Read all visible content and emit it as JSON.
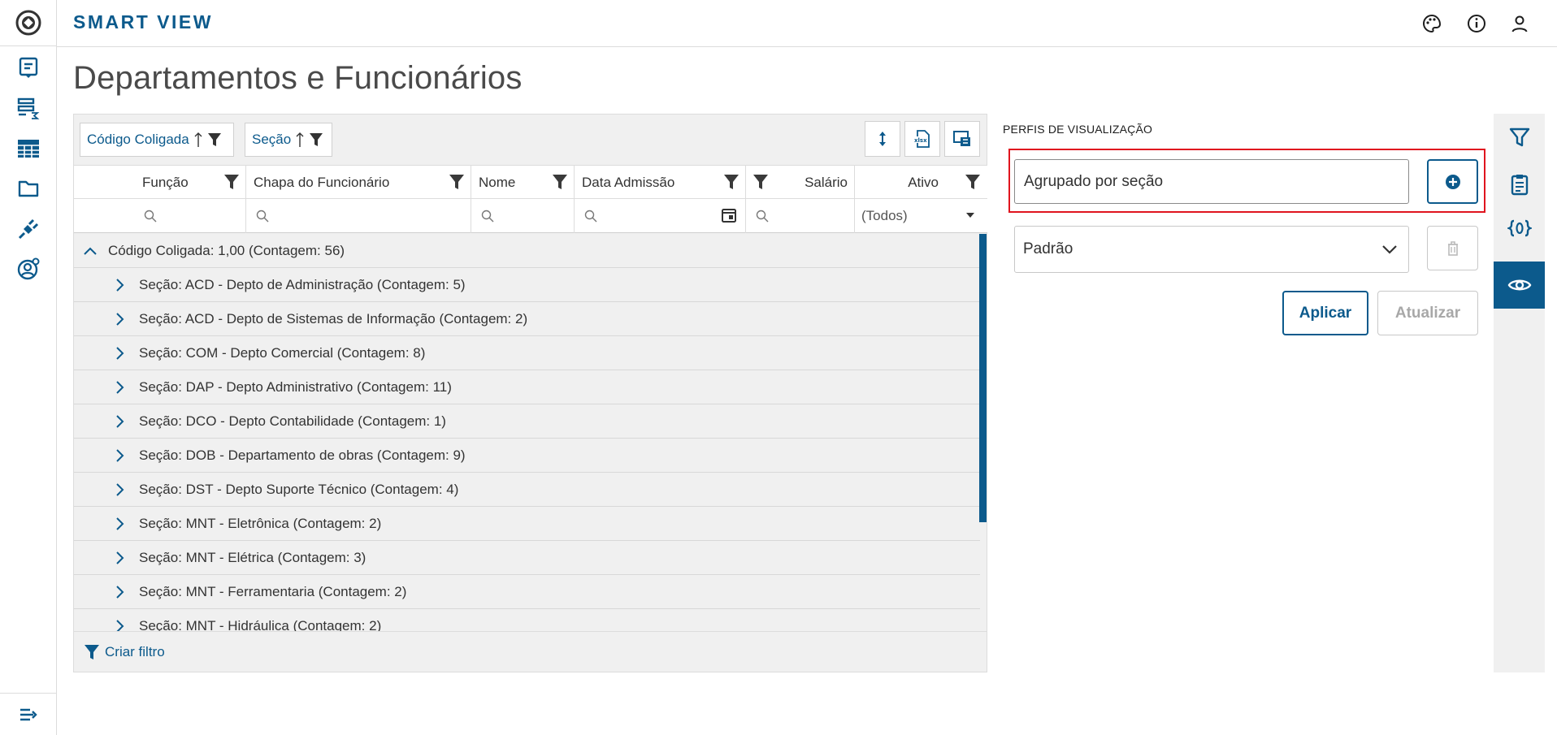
{
  "header": {
    "brand": "SMART VIEW",
    "icons": [
      "palette-icon",
      "info-icon",
      "user-icon"
    ]
  },
  "nav": {
    "icons": [
      "report-icon",
      "summary-icon",
      "table-icon",
      "folder-icon",
      "plug-icon",
      "user-settings-icon"
    ],
    "collapse_icon": "expand-menu-icon"
  },
  "page": {
    "title": "Departamentos e Funcionários"
  },
  "grid": {
    "group_chips": [
      "Código Coligada",
      "Seção"
    ],
    "toolbar_icons": [
      "row-height-icon",
      "export-xlsx-icon",
      "column-chooser-icon"
    ],
    "columns": [
      "Função",
      "Chapa do Funcionário",
      "Nome",
      "Data Admissão",
      "Salário",
      "Ativo"
    ],
    "active_filter_value": "(Todos)",
    "top_group": "Código Coligada: 1,00 (Contagem: 56)",
    "groups": [
      "Seção: ACD - Depto de Administração (Contagem: 5)",
      "Seção: ACD - Depto de Sistemas de Informação (Contagem: 2)",
      "Seção: COM - Depto Comercial (Contagem: 8)",
      "Seção: DAP - Depto Administrativo (Contagem: 11)",
      "Seção: DCO - Depto Contabilidade (Contagem: 1)",
      "Seção: DOB - Departamento de obras (Contagem: 9)",
      "Seção: DST - Depto Suporte Técnico (Contagem: 4)",
      "Seção: MNT - Eletrônica (Contagem: 2)",
      "Seção: MNT - Elétrica (Contagem: 3)",
      "Seção: MNT - Ferramentaria (Contagem: 2)",
      "Seção: MNT - Hidráulica (Contagem: 2)"
    ],
    "create_filter": "Criar filtro"
  },
  "profiles": {
    "title": "PERFIS DE VISUALIZAÇÃO",
    "name_value": "Agrupado por seção",
    "selected_profile": "Padrão",
    "apply_label": "Aplicar",
    "update_label": "Atualizar"
  },
  "side_tabs": [
    "filter-icon",
    "clipboard-icon",
    "variables-icon",
    "eye-icon"
  ],
  "colors": {
    "primary": "#0c5a8c",
    "highlight": "#e0141e"
  }
}
